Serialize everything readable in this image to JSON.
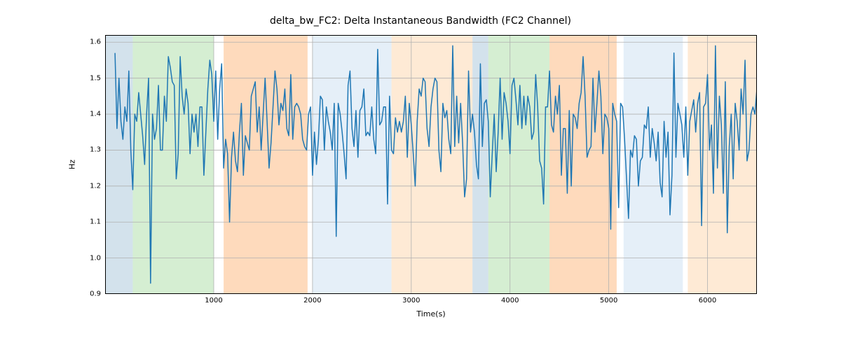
{
  "chart_data": {
    "type": "line",
    "title": "delta_bw_FC2: Delta Instantaneous Bandwidth (FC2 Channel)",
    "xlabel": "Time(s)",
    "ylabel": "Hz",
    "xlim": [
      -100,
      6500
    ],
    "ylim": [
      0.9,
      1.62
    ],
    "xticks": [
      1000,
      2000,
      3000,
      4000,
      5000,
      6000
    ],
    "yticks": [
      0.9,
      1.0,
      1.1,
      1.2,
      1.3,
      1.4,
      1.5,
      1.6
    ],
    "series": [
      {
        "name": "delta_bw_FC2",
        "color": "#1f77b4",
        "x_step": 20,
        "values": [
          1.57,
          1.36,
          1.5,
          1.38,
          1.33,
          1.42,
          1.38,
          1.52,
          1.3,
          1.19,
          1.4,
          1.38,
          1.46,
          1.4,
          1.34,
          1.26,
          1.4,
          1.5,
          0.93,
          1.4,
          1.33,
          1.36,
          1.48,
          1.3,
          1.3,
          1.45,
          1.38,
          1.56,
          1.53,
          1.49,
          1.48,
          1.22,
          1.29,
          1.56,
          1.45,
          1.4,
          1.47,
          1.43,
          1.29,
          1.4,
          1.35,
          1.4,
          1.31,
          1.42,
          1.42,
          1.23,
          1.35,
          1.47,
          1.55,
          1.51,
          1.38,
          1.52,
          1.33,
          1.47,
          1.54,
          1.25,
          1.33,
          1.29,
          1.1,
          1.28,
          1.35,
          1.27,
          1.24,
          1.35,
          1.43,
          1.23,
          1.34,
          1.32,
          1.3,
          1.45,
          1.47,
          1.49,
          1.35,
          1.42,
          1.3,
          1.4,
          1.5,
          1.38,
          1.25,
          1.32,
          1.42,
          1.52,
          1.47,
          1.37,
          1.43,
          1.41,
          1.47,
          1.36,
          1.34,
          1.51,
          1.33,
          1.42,
          1.43,
          1.42,
          1.4,
          1.33,
          1.31,
          1.3,
          1.4,
          1.42,
          1.23,
          1.35,
          1.26,
          1.33,
          1.45,
          1.44,
          1.3,
          1.42,
          1.38,
          1.35,
          1.3,
          1.43,
          1.06,
          1.43,
          1.4,
          1.35,
          1.29,
          1.22,
          1.48,
          1.52,
          1.36,
          1.31,
          1.41,
          1.28,
          1.41,
          1.42,
          1.47,
          1.34,
          1.35,
          1.34,
          1.42,
          1.33,
          1.29,
          1.58,
          1.37,
          1.38,
          1.42,
          1.42,
          1.15,
          1.45,
          1.3,
          1.29,
          1.39,
          1.35,
          1.38,
          1.35,
          1.38,
          1.45,
          1.28,
          1.43,
          1.37,
          1.29,
          1.2,
          1.38,
          1.47,
          1.45,
          1.5,
          1.49,
          1.36,
          1.31,
          1.42,
          1.47,
          1.5,
          1.49,
          1.3,
          1.24,
          1.43,
          1.39,
          1.41,
          1.33,
          1.29,
          1.59,
          1.31,
          1.45,
          1.32,
          1.43,
          1.32,
          1.17,
          1.22,
          1.52,
          1.35,
          1.4,
          1.35,
          1.26,
          1.22,
          1.54,
          1.31,
          1.43,
          1.44,
          1.38,
          1.17,
          1.29,
          1.4,
          1.24,
          1.35,
          1.5,
          1.33,
          1.46,
          1.43,
          1.38,
          1.29,
          1.48,
          1.5,
          1.44,
          1.37,
          1.48,
          1.36,
          1.45,
          1.37,
          1.45,
          1.42,
          1.33,
          1.35,
          1.51,
          1.42,
          1.27,
          1.25,
          1.15,
          1.42,
          1.42,
          1.52,
          1.37,
          1.35,
          1.45,
          1.4,
          1.48,
          1.23,
          1.36,
          1.36,
          1.18,
          1.41,
          1.2,
          1.4,
          1.39,
          1.36,
          1.43,
          1.46,
          1.56,
          1.45,
          1.28,
          1.3,
          1.31,
          1.5,
          1.35,
          1.43,
          1.52,
          1.45,
          1.29,
          1.4,
          1.39,
          1.36,
          1.08,
          1.43,
          1.4,
          1.38,
          1.14,
          1.43,
          1.42,
          1.33,
          1.22,
          1.11,
          1.3,
          1.28,
          1.34,
          1.33,
          1.2,
          1.27,
          1.28,
          1.37,
          1.36,
          1.42,
          1.28,
          1.36,
          1.32,
          1.27,
          1.35,
          1.21,
          1.17,
          1.38,
          1.28,
          1.35,
          1.12,
          1.23,
          1.57,
          1.28,
          1.43,
          1.4,
          1.37,
          1.28,
          1.42,
          1.23,
          1.38,
          1.41,
          1.44,
          1.35,
          1.43,
          1.46,
          1.09,
          1.42,
          1.43,
          1.51,
          1.3,
          1.37,
          1.18,
          1.59,
          1.25,
          1.45,
          1.37,
          1.18,
          1.49,
          1.07,
          1.31,
          1.4,
          1.22,
          1.43,
          1.38,
          1.3,
          1.47,
          1.4,
          1.55,
          1.27,
          1.3,
          1.4,
          1.42,
          1.4,
          1.47
        ]
      }
    ],
    "background_spans": [
      {
        "x0": -100,
        "x1": 180,
        "color": "#9ebfd5",
        "alpha": 0.45
      },
      {
        "x0": 180,
        "x1": 1000,
        "color": "#a1d99b",
        "alpha": 0.45
      },
      {
        "x0": 1100,
        "x1": 1950,
        "color": "#fdae6b",
        "alpha": 0.45
      },
      {
        "x0": 2000,
        "x1": 2800,
        "color": "#c6dbef",
        "alpha": 0.45
      },
      {
        "x0": 2800,
        "x1": 3620,
        "color": "#fdd0a2",
        "alpha": 0.45
      },
      {
        "x0": 3620,
        "x1": 3780,
        "color": "#9ebfd5",
        "alpha": 0.45
      },
      {
        "x0": 3780,
        "x1": 4400,
        "color": "#a1d99b",
        "alpha": 0.45
      },
      {
        "x0": 4400,
        "x1": 5080,
        "color": "#fdae6b",
        "alpha": 0.45
      },
      {
        "x0": 5150,
        "x1": 5750,
        "color": "#c6dbef",
        "alpha": 0.45
      },
      {
        "x0": 5800,
        "x1": 6500,
        "color": "#fdd0a2",
        "alpha": 0.45
      }
    ]
  }
}
